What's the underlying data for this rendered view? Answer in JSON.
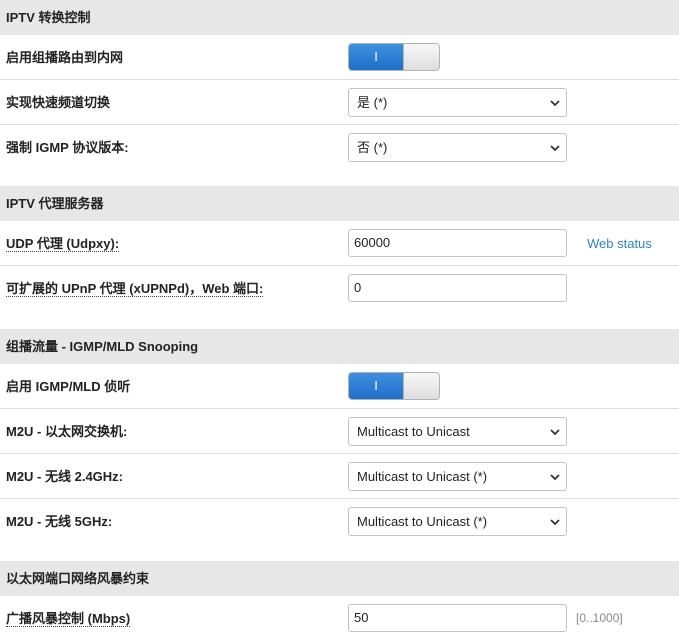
{
  "sections": {
    "iptv_switch": {
      "title": "IPTV 转换控制",
      "multicast_routing": {
        "label": "启用组播路由到内网",
        "toggle_on_glyph": "I"
      },
      "fast_switch": {
        "label": "实现快速频道切换",
        "value": "是 (*)"
      },
      "igmp_version": {
        "label": "强制 IGMP 协议版本:",
        "value": "否 (*)"
      }
    },
    "iptv_proxy": {
      "title": "IPTV 代理服务器",
      "udpxy": {
        "label": "UDP 代理 (Udpxy):",
        "value": "60000",
        "link": "Web status"
      },
      "xupnpd": {
        "label": "可扩展的 UPnP 代理 (xUPNPd)，Web 端口:",
        "value": "0"
      }
    },
    "snooping": {
      "title": "组播流量 - IGMP/MLD Snooping",
      "enable_snooping": {
        "label": "启用 IGMP/MLD 侦听",
        "toggle_on_glyph": "I"
      },
      "m2u_ethernet": {
        "label": "M2U - 以太网交换机:",
        "value": "Multicast to Unicast"
      },
      "m2u_24": {
        "label": "M2U - 无线 2.4GHz:",
        "value": "Multicast to Unicast (*)"
      },
      "m2u_5": {
        "label": "M2U - 无线 5GHz:",
        "value": "Multicast to Unicast (*)"
      }
    },
    "storm": {
      "title": "以太网端口网络风暴约束",
      "broadcast": {
        "label": "广播风暴控制 (Mbps)",
        "value": "50",
        "hint": "[0..1000]"
      }
    }
  },
  "colors": {
    "header_bg": "#e7e7e7",
    "toggle_on": "#2a7bd5",
    "link": "#2e86b8",
    "row_divider": "#dddddd"
  },
  "icons": {
    "select_arrow": "chevron-down-icon"
  }
}
